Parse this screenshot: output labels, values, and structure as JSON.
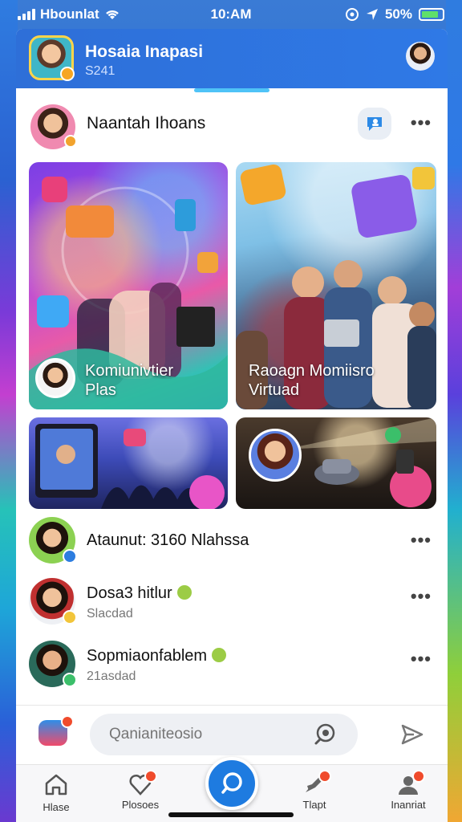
{
  "status_bar": {
    "carrier": "Hbounlat",
    "time": "10:AM",
    "battery": "50%"
  },
  "header": {
    "title": "Hosaia Inapasi",
    "subtitle": "S241"
  },
  "post": {
    "author": "Naantah Ihoans"
  },
  "tiles": [
    {
      "label_line1": "Komiunivtier",
      "label_line2": "Plas"
    },
    {
      "label_line1": "Raoagn Momiisro",
      "label_line2": "Virtuad"
    }
  ],
  "list": [
    {
      "name": "Ataunut: 3160 Nlahssa",
      "sub": ""
    },
    {
      "name": "Dosa3 hitlur",
      "sub": "Slacdad"
    },
    {
      "name": "Sopmiaonfablem",
      "sub": "21asdad"
    }
  ],
  "composer": {
    "placeholder": "Qanianiteosio"
  },
  "nav": {
    "items": [
      {
        "label": "Hlase",
        "icon": "home-icon"
      },
      {
        "label": "Plosoes",
        "icon": "heart-icon"
      },
      {
        "label": "Tlapt",
        "icon": "rocket-icon"
      },
      {
        "label": "Inanriat",
        "icon": "profile-icon"
      }
    ]
  },
  "colors": {
    "header_blue": "#2f79e6",
    "accent": "#1e7be0",
    "badge_red": "#f04b2c"
  }
}
